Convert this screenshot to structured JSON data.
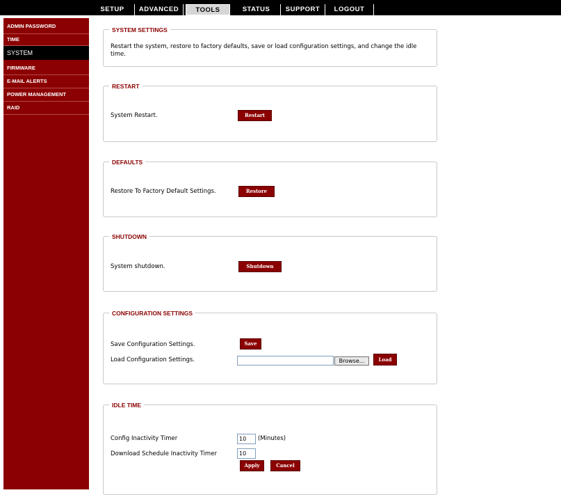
{
  "nav": {
    "tabs": [
      {
        "label": "SETUP"
      },
      {
        "label": "ADVANCED"
      },
      {
        "label": "TOOLS"
      },
      {
        "label": "STATUS"
      },
      {
        "label": "SUPPORT"
      },
      {
        "label": "LOGOUT"
      }
    ],
    "active_tab": "TOOLS"
  },
  "sidebar": {
    "items": [
      {
        "label": "ADMIN PASSWORD"
      },
      {
        "label": "TIME"
      },
      {
        "label": "SYSTEM"
      },
      {
        "label": "FIRMWARE"
      },
      {
        "label": "E-MAIL ALERTS"
      },
      {
        "label": "POWER MANAGEMENT"
      },
      {
        "label": "RAID"
      }
    ],
    "active_item": "SYSTEM"
  },
  "system_settings": {
    "title": "SYSTEM SETTINGS",
    "description": "Restart the system, restore to factory defaults, save or load configuration settings, and change the idle time."
  },
  "restart": {
    "title": "RESTART",
    "label": "System Restart.",
    "button": "Restart"
  },
  "defaults": {
    "title": "DEFAULTS",
    "label": "Restore To Factory Default Settings.",
    "button": "Restore"
  },
  "shutdown": {
    "title": "SHUTDOWN",
    "label": "System shutdown.",
    "button": "Shutdown"
  },
  "configuration": {
    "title": "CONFIGURATION SETTINGS",
    "save_label": "Save Configuration Settings.",
    "save_button": "Save",
    "load_label": "Load Configuration Settings.",
    "file_value": "",
    "browse_button": "Browse...",
    "load_button": "Load"
  },
  "idle_time": {
    "title": "IDLE TIME",
    "config_timer_label": "Config Inactivity Timer",
    "config_timer_value": "10",
    "minutes_label": "(Minutes)",
    "download_timer_label": "Download Schedule Inactivity Timer",
    "download_timer_value": "10",
    "apply_button": "Apply",
    "cancel_button": "Cancel"
  },
  "colors": {
    "accent": "#8b0000",
    "topbar": "#000000",
    "border": "#c8c8c8"
  }
}
